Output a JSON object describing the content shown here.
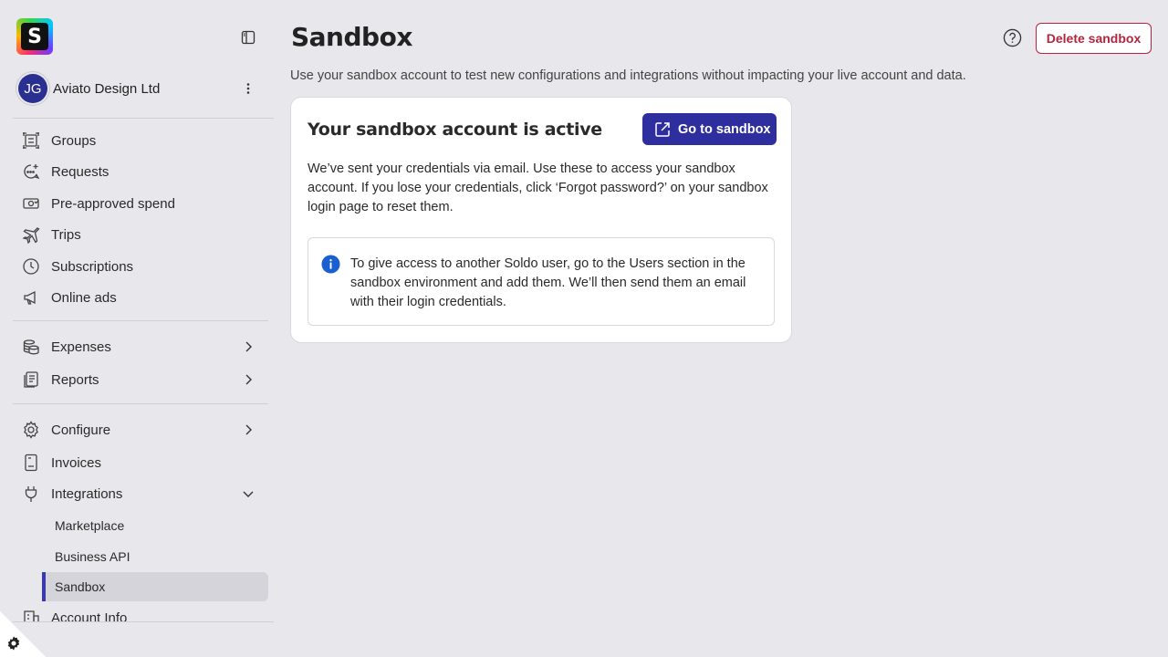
{
  "app": {
    "logo_letter": "S",
    "page_title": "Sandbox",
    "description": "Use your sandbox account to test new configurations and integrations without impacting your live account and data."
  },
  "account": {
    "initials": "JG",
    "name": "Aviato Design Ltd"
  },
  "sidebar": {
    "items": [
      {
        "label": "Groups",
        "icon": "groups-icon"
      },
      {
        "label": "Requests",
        "icon": "requests-icon"
      },
      {
        "label": "Pre-approved spend",
        "icon": "money-icon"
      },
      {
        "label": "Trips",
        "icon": "plane-icon"
      },
      {
        "label": "Subscriptions",
        "icon": "clock-icon"
      },
      {
        "label": "Online ads",
        "icon": "megaphone-icon"
      },
      {
        "label": "Expenses",
        "icon": "coins-icon"
      },
      {
        "label": "Reports",
        "icon": "report-icon"
      },
      {
        "label": "Configure",
        "icon": "gear-icon"
      },
      {
        "label": "Invoices",
        "icon": "receipt-icon"
      },
      {
        "label": "Integrations",
        "icon": "plug-icon"
      },
      {
        "label": "Account Info",
        "icon": "building-icon"
      }
    ],
    "sub_items": [
      {
        "label": "Marketplace"
      },
      {
        "label": "Business API"
      },
      {
        "label": "Sandbox"
      }
    ]
  },
  "header": {
    "delete_label": "Delete sandbox"
  },
  "card": {
    "title": "Your sandbox account is active",
    "go_label": "Go to sandbox",
    "body": "We’ve sent your credentials via email. Use these to access your sandbox account. If you lose your credentials, click ‘Forgot password?’ on your sandbox login page to reset them.",
    "info": "To give access to another Soldo user, go to the Users section in the sandbox environment and add them. We’ll then send them an email with their login credentials."
  },
  "colors": {
    "primary": "#2e2e9e",
    "danger": "#b3243e",
    "info": "#1a5fd0",
    "background": "#e8e8ec"
  }
}
